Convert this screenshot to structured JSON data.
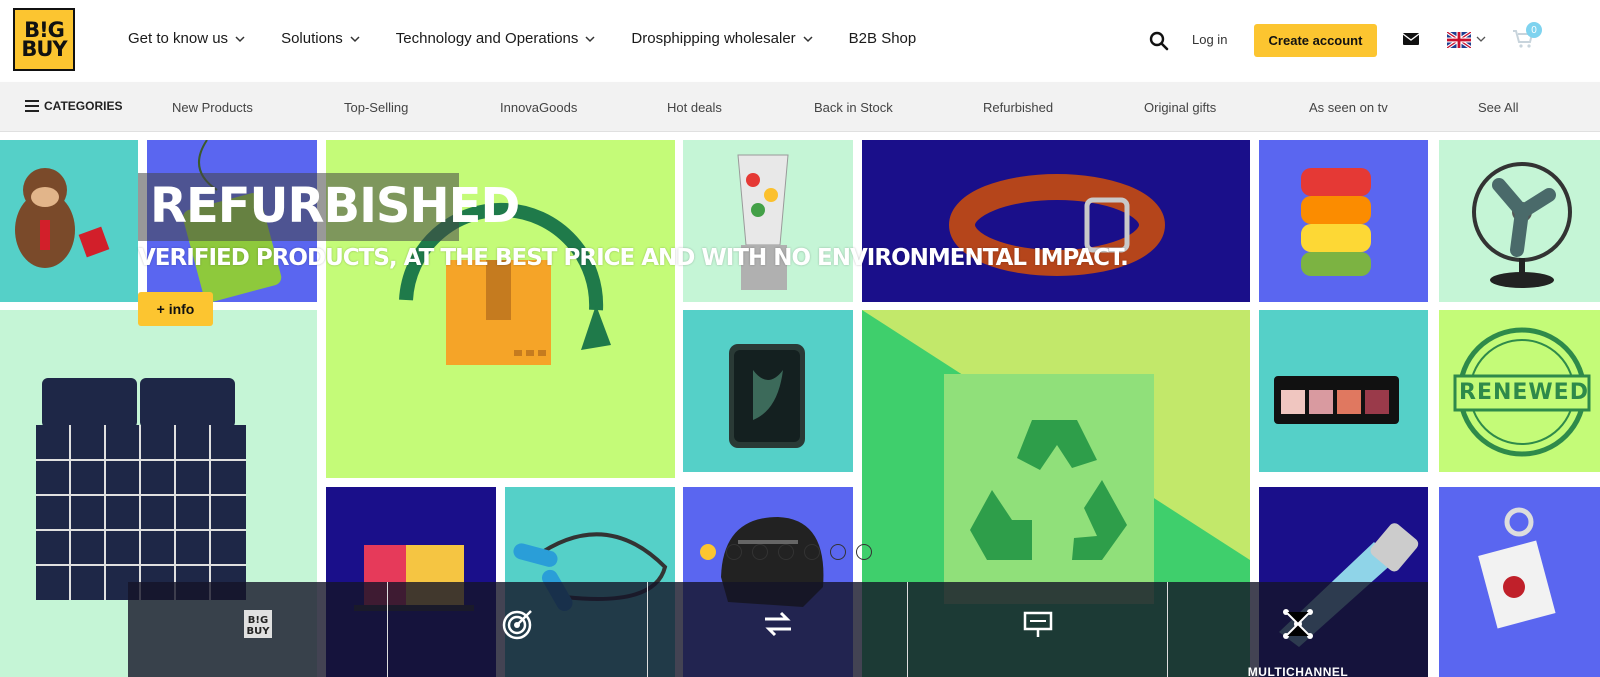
{
  "brand": {
    "logo_line1": "B!G",
    "logo_line2": "BUY",
    "accent_color": "#fcc530"
  },
  "header": {
    "nav": [
      {
        "label": "Get to know us",
        "has_dropdown": true
      },
      {
        "label": "Solutions",
        "has_dropdown": true
      },
      {
        "label": "Technology and Operations",
        "has_dropdown": true
      },
      {
        "label": "Drosphipping wholesaler",
        "has_dropdown": true
      },
      {
        "label": "B2B Shop",
        "has_dropdown": false
      }
    ],
    "login_label": "Log in",
    "create_account_label": "Create account",
    "cart_count": "0",
    "language_flag": "uk-flag-icon"
  },
  "categories_bar": {
    "menu_label": "CATEGORIES",
    "links": [
      "New Products",
      "Top-Selling",
      "InnovaGoods",
      "Hot deals",
      "Back in Stock",
      "Refurbished",
      "Original gifts",
      "As seen on tv",
      "See All"
    ]
  },
  "hero": {
    "title": "REFURBISHED",
    "subtitle": "VERIFIED PRODUCTS, AT THE BEST PRICE AND WITH NO ENVIRONMENTAL IMPACT.",
    "info_button_label": "+ info",
    "slide_count": 7,
    "active_slide": 1,
    "tile_colors": {
      "teal": "#55d0c8",
      "blue": "#5a66f0",
      "lime": "#c4fb78",
      "mint": "#c5f5d6",
      "navy": "#1a0f8a"
    },
    "stamp_text": "RENEWED"
  },
  "bottom_bar": {
    "items": [
      {
        "icon": "bigbuy-logo-icon",
        "label": ""
      },
      {
        "icon": "target-icon",
        "label": ""
      },
      {
        "icon": "exchange-arrows-icon",
        "label": ""
      },
      {
        "icon": "presentation-board-icon",
        "label": ""
      },
      {
        "icon": "network-nodes-icon",
        "label": "MULTICHANNEL"
      }
    ]
  }
}
